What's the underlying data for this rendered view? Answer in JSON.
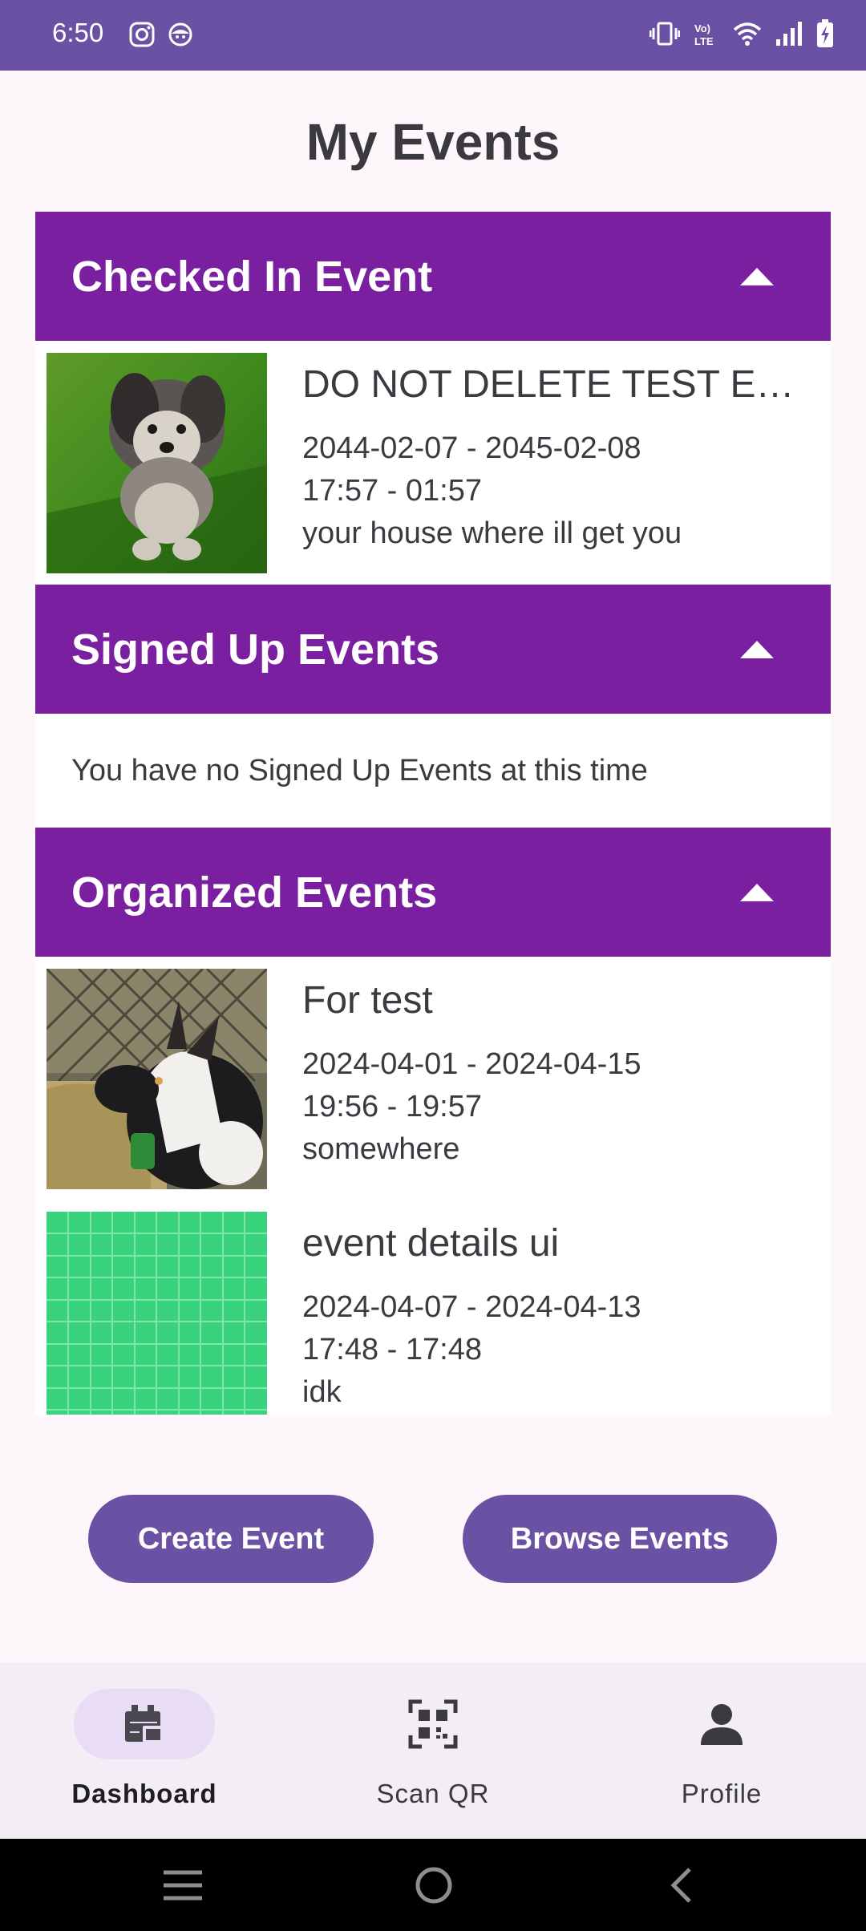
{
  "status_bar": {
    "time": "6:50",
    "icons": [
      "instagram-icon",
      "face-icon",
      "vibrate-icon",
      "volte-icon",
      "wifi-icon",
      "signal-icon",
      "battery-charging-icon"
    ]
  },
  "page": {
    "title": "My Events"
  },
  "sections": {
    "checked_in": {
      "title": "Checked In Event",
      "events": [
        {
          "name": "DO NOT DELETE TEST EVENT",
          "dates": "2044-02-07 - 2045-02-08",
          "times": "17:57 - 01:57",
          "location": "your house where ill get you",
          "image": "dog-photo"
        }
      ]
    },
    "signed_up": {
      "title": "Signed Up Events",
      "empty_message": "You have no Signed Up Events at this time"
    },
    "organized": {
      "title": "Organized Events",
      "events": [
        {
          "name": "For test",
          "dates": "2024-04-01 - 2024-04-15",
          "times": "19:56 - 19:57",
          "location": "somewhere",
          "image": "goat-photo"
        },
        {
          "name": "event details ui",
          "dates": "2024-04-07 - 2024-04-13",
          "times": "17:48 - 17:48",
          "location": "idk",
          "image": "green-grid-image"
        }
      ]
    }
  },
  "actions": {
    "create_label": "Create Event",
    "browse_label": "Browse Events"
  },
  "bottom_nav": {
    "items": [
      {
        "label": "Dashboard",
        "icon": "dashboard-icon",
        "active": true
      },
      {
        "label": "Scan QR",
        "icon": "qr-scan-icon",
        "active": false
      },
      {
        "label": "Profile",
        "icon": "person-icon",
        "active": false
      }
    ]
  },
  "colors": {
    "status_bar": "#6a51a3",
    "section_header": "#7a1fa0",
    "button": "#6a51a3",
    "background": "#fdf6fb",
    "nav_background": "#f3edf6",
    "nav_active_indicator": "#e9ddf5"
  }
}
